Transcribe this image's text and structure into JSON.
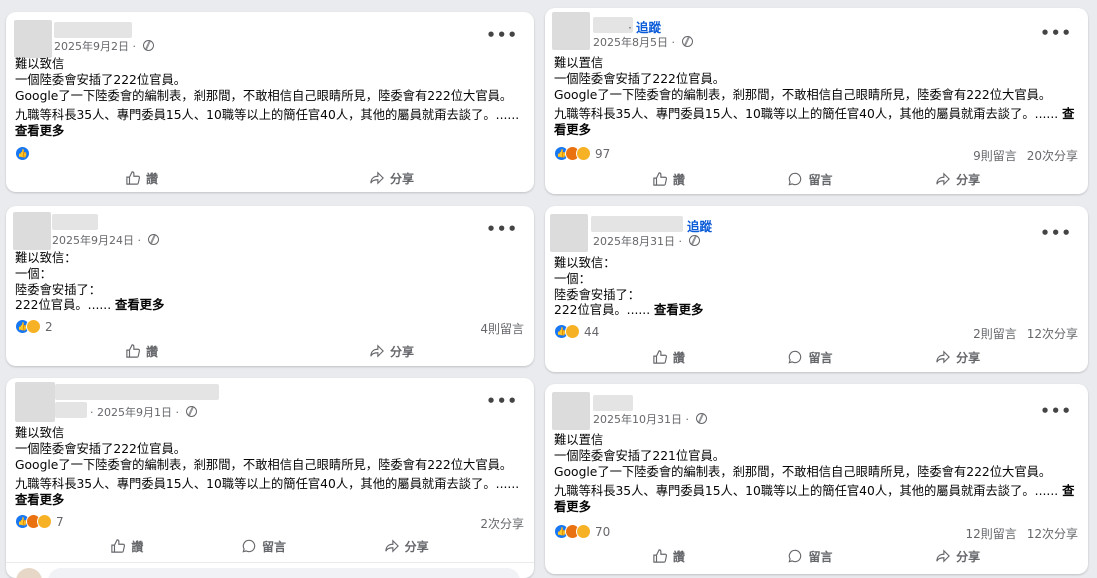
{
  "actions": {
    "like": "讚",
    "comment": "留言",
    "share": "分享"
  },
  "posts": [
    {
      "follow": "",
      "date": "2025年9月2日",
      "lines": [
        "難以致信",
        "一個陸委會安插了222位官員。",
        "Google了一下陸委會的編制表，剎那間，不敢相信自己眼睛所見，陸委會有222位大官員。",
        "九職等科長35人、專門委員15人、10職等以上的簡任官40人，其他的屬員就甭去談了。......"
      ],
      "see_more": "查看更多",
      "reaction_count": "",
      "comments": "",
      "shares": ""
    },
    {
      "follow": "追蹤",
      "date": "2025年8月5日",
      "lines": [
        "難以置信",
        "一個陸委會安插了222位官員。",
        "Google了一下陸委會的編制表，剎那間，不敢相信自己眼睛所見，陸委會有222位大官員。",
        "九職等科長35人、專門委員15人、10職等以上的簡任官40人，其他的屬員就甭去談了。......"
      ],
      "see_more": "查看更多",
      "reaction_count": "97",
      "comments": "9則留言",
      "shares": "20次分享"
    },
    {
      "follow": "",
      "date": "2025年9月24日",
      "lines": [
        "難以致信：",
        "一個：",
        "陸委會安插了：",
        "222位官員。......"
      ],
      "see_more": "查看更多",
      "reaction_count": "2",
      "comments": "4則留言",
      "shares": ""
    },
    {
      "follow": "追蹤",
      "date": "2025年8月31日",
      "lines": [
        "難以致信：",
        "一個：",
        "陸委會安插了：",
        "222位官員。......"
      ],
      "see_more": "查看更多",
      "reaction_count": "44",
      "comments": "2則留言",
      "shares": "12次分享"
    },
    {
      "follow": "",
      "date": "2025年9月1日",
      "lines": [
        "難以致信",
        "一個陸委會安插了222位官員。",
        "Google了一下陸委會的編制表，剎那間，不敢相信自己眼睛所見，陸委會有222位大官員。",
        "九職等科長35人、專門委員15人、10職等以上的簡任官40人，其他的屬員就甭去談了。......"
      ],
      "see_more": "查看更多",
      "reaction_count": "7",
      "comments": "",
      "shares": "2次分享"
    },
    {
      "follow": "",
      "date": "2025年10月31日",
      "lines": [
        "難以置信",
        "一個陸委會安插了221位官員。",
        "Google了一下陸委會的編制表，剎那間，不敢相信自己眼睛所見，陸委會有222位大官員。",
        "九職等科長35人、專門委員15人、10職等以上的簡任官40人，其他的屬員就甭去談了。......"
      ],
      "see_more": "查看更多",
      "reaction_count": "70",
      "comments": "12則留言",
      "shares": "12次分享"
    }
  ]
}
